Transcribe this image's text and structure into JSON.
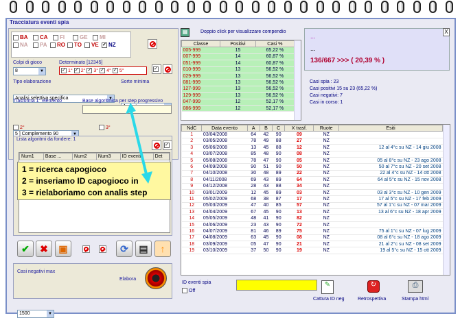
{
  "window": {
    "title": "Tracciatura eventi spia",
    "close": "X"
  },
  "wheels": [
    {
      "code": "BA",
      "checked": false
    },
    {
      "code": "CA",
      "checked": false
    },
    {
      "code": "FI",
      "checked": false
    },
    {
      "code": "GE",
      "checked": false
    },
    {
      "code": "MI",
      "checked": false
    },
    {
      "code": "NA",
      "checked": false
    },
    {
      "code": "PA",
      "checked": false
    },
    {
      "code": "RO",
      "checked": false
    },
    {
      "code": "TO",
      "checked": false
    },
    {
      "code": "VE",
      "checked": false
    },
    {
      "code": "NZ",
      "checked": true
    }
  ],
  "colpi": {
    "label": "Colpi di gioco",
    "value": "8"
  },
  "determinato": {
    "label": "Determinato [12345]",
    "items": [
      {
        "label": "1°",
        "checked": true
      },
      {
        "label": "2°",
        "checked": true
      },
      {
        "label": "3°",
        "checked": true
      },
      {
        "label": "4°",
        "checked": true
      },
      {
        "label": "5°",
        "checked": true
      }
    ]
  },
  "tipo": {
    "label": "Tipo elaborazione",
    "value": "Analisi selettiva specifica"
  },
  "sorte": {
    "label": "Sorte minima",
    "value": "Ambata"
  },
  "trasforma": {
    "label": "Trasforma 1° elemento",
    "value": "5 ] Complemento 90"
  },
  "base": {
    "label": "Base algoritmica per step progressivo",
    "value": ""
  },
  "pos2": {
    "label": "2°"
  },
  "pos3": {
    "label": "3°"
  },
  "lista": {
    "label": "Lista algoritmi da fondere: 1",
    "columns": [
      "Num1",
      "Base ...",
      "Num2",
      "Num3",
      "ID eventi",
      "Det"
    ]
  },
  "annotation": {
    "line1": "1 = ricerca capogioco",
    "line2": "2 = inseriamo ID capogioco in",
    "line3": "3 = rielaboriamo con analis step"
  },
  "casi_neg": {
    "label": "Casi negativi max",
    "value": "1500"
  },
  "elabora": {
    "label": "Elabora"
  },
  "compendio": {
    "hint": "Doppio click per visualizzare compendio",
    "columns": [
      "Classe",
      "Positivi",
      "Casi %"
    ],
    "rows": [
      [
        "005-999",
        "15",
        "65,22 %"
      ],
      [
        "007-999",
        "14",
        "60,87 %"
      ],
      [
        "051-999",
        "14",
        "60,87 %"
      ],
      [
        "010-999",
        "13",
        "56,52 %"
      ],
      [
        "029-999",
        "13",
        "56,52 %"
      ],
      [
        "081-999",
        "13",
        "56,52 %"
      ],
      [
        "127-999",
        "13",
        "56,52 %"
      ],
      [
        "129-999",
        "13",
        "56,52 %"
      ],
      [
        "047-999",
        "12",
        "52,17 %"
      ],
      [
        "086-999",
        "12",
        "52,17 %"
      ]
    ]
  },
  "summary": {
    "dots1": "...",
    "dots2": "...",
    "ratio": "136/667 >>> ( 20,39 % )",
    "casi_spia": "Casi spia : 23",
    "casi_pos": "Casi positivi 15 su 23 (65,22 %)",
    "casi_neg": "Casi negativi: 7",
    "casi_corso": "Casi in corso: 1"
  },
  "events": {
    "columns": [
      "NdC",
      "Data evento",
      "A",
      "B",
      "C",
      "X trasf.",
      "Ruote",
      "Esiti"
    ],
    "rows": [
      [
        "1",
        "03/04/2008",
        "64",
        "42",
        "90",
        "09",
        "NZ",
        ""
      ],
      [
        "2",
        "03/05/2008",
        "78",
        "49",
        "88",
        "27",
        "NZ",
        ""
      ],
      [
        "3",
        "05/06/2008",
        "13",
        "45",
        "88",
        "12",
        "NZ",
        "12 al 4°c su NZ - 14 giu 2008"
      ],
      [
        "4",
        "03/07/2008",
        "85",
        "48",
        "90",
        "08",
        "NZ",
        ""
      ],
      [
        "5",
        "05/08/2008",
        "78",
        "47",
        "90",
        "05",
        "NZ",
        "05 al 8°c su NZ - 23 ago 2008"
      ],
      [
        "6",
        "04/09/2008",
        "90",
        "51",
        "90",
        "50",
        "NZ",
        "50 al 7°c su NZ - 20 set 2008"
      ],
      [
        "7",
        "04/10/2008",
        "30",
        "48",
        "89",
        "22",
        "NZ",
        "22 al 4°c su NZ - 14 ott 2008"
      ],
      [
        "8",
        "04/11/2008",
        "69",
        "43",
        "89",
        "64",
        "NZ",
        "64 al 5°c su NZ - 15 nov 2008"
      ],
      [
        "9",
        "04/12/2008",
        "28",
        "43",
        "88",
        "34",
        "NZ",
        ""
      ],
      [
        "10",
        "03/01/2009",
        "12",
        "45",
        "89",
        "03",
        "NZ",
        "03 al 3°c su NZ - 10 gen 2009"
      ],
      [
        "11",
        "05/02/2009",
        "68",
        "38",
        "87",
        "17",
        "NZ",
        "17 al 5°c su NZ - 17 feb 2009"
      ],
      [
        "12",
        "05/03/2009",
        "47",
        "40",
        "85",
        "57",
        "NZ",
        "57 al 1°c su NZ - 07 mar 2009"
      ],
      [
        "13",
        "04/04/2009",
        "67",
        "45",
        "90",
        "13",
        "NZ",
        "13 al 6°c su NZ - 18 apr 2009"
      ],
      [
        "14",
        "05/05/2009",
        "48",
        "41",
        "90",
        "82",
        "NZ",
        ""
      ],
      [
        "15",
        "04/06/2009",
        "23",
        "43",
        "90",
        "72",
        "NZ",
        ""
      ],
      [
        "16",
        "04/07/2009",
        "81",
        "46",
        "89",
        "75",
        "NZ",
        "75 al 1°c su NZ - 07 lug 2009"
      ],
      [
        "17",
        "04/08/2009",
        "63",
        "45",
        "90",
        "08",
        "NZ",
        "08 al 6°c su NZ - 18 ago 2009"
      ],
      [
        "18",
        "03/09/2009",
        "05",
        "47",
        "90",
        "21",
        "NZ",
        "21 al 2°c su NZ - 08 set 2009"
      ],
      [
        "19",
        "03/10/2009",
        "37",
        "50",
        "90",
        "19",
        "NZ",
        "19 al 5°c su NZ - 15 ott 2009"
      ]
    ]
  },
  "id_spia": {
    "label": "ID eventi spia",
    "off": "Off",
    "value": ""
  },
  "actions": {
    "cattura": "Cattura ID neg",
    "retro": "Retrospettiva",
    "stampa": "Stampa html"
  }
}
